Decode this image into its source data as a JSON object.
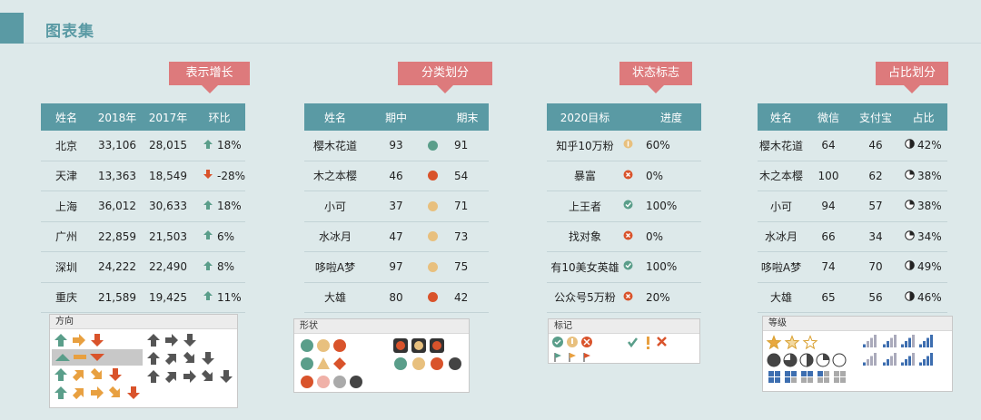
{
  "header": {
    "title": "图表集"
  },
  "callouts": {
    "c1": "表示增长",
    "c2": "分类划分",
    "c3": "状态标志",
    "c4": "占比划分"
  },
  "table1": {
    "headers": [
      "姓名",
      "2018年",
      "2017年",
      "环比"
    ],
    "rows": [
      {
        "name": "北京",
        "y2018": "33,106",
        "y2017": "28,015",
        "trend": "up",
        "pct": "18%"
      },
      {
        "name": "天津",
        "y2018": "13,363",
        "y2017": "18,549",
        "trend": "down",
        "pct": "-28%"
      },
      {
        "name": "上海",
        "y2018": "36,012",
        "y2017": "30,633",
        "trend": "up",
        "pct": "18%"
      },
      {
        "name": "广州",
        "y2018": "22,859",
        "y2017": "21,503",
        "trend": "up",
        "pct": "6%"
      },
      {
        "name": "深圳",
        "y2018": "24,222",
        "y2017": "22,490",
        "trend": "up",
        "pct": "8%"
      },
      {
        "name": "重庆",
        "y2018": "21,589",
        "y2017": "19,425",
        "trend": "up",
        "pct": "11%"
      }
    ]
  },
  "table2": {
    "headers": [
      "姓名",
      "期中",
      "期末"
    ],
    "rows": [
      {
        "name": "樱木花道",
        "mid": "93",
        "final": "91",
        "color": "#5a9e8a"
      },
      {
        "name": "木之本樱",
        "mid": "46",
        "final": "54",
        "color": "#d9532b"
      },
      {
        "name": "小可",
        "mid": "37",
        "final": "71",
        "color": "#e8c07e"
      },
      {
        "name": "水冰月",
        "mid": "47",
        "final": "73",
        "color": "#e8c07e"
      },
      {
        "name": "哆啦A梦",
        "mid": "97",
        "final": "75",
        "color": "#e8c07e"
      },
      {
        "name": "大雄",
        "mid": "80",
        "final": "42",
        "color": "#d9532b"
      }
    ]
  },
  "table3": {
    "headers": [
      "2020目标",
      "进度"
    ],
    "rows": [
      {
        "goal": "知乎10万粉",
        "status": "warn",
        "progress": "60%"
      },
      {
        "goal": "暴富",
        "status": "x",
        "progress": "0%"
      },
      {
        "goal": "上王者",
        "status": "ok",
        "progress": "100%"
      },
      {
        "goal": "找对象",
        "status": "x",
        "progress": "0%"
      },
      {
        "goal": "有10美女英雄",
        "status": "ok",
        "progress": "100%"
      },
      {
        "goal": "公众号5万粉",
        "status": "x",
        "progress": "20%"
      }
    ]
  },
  "table4": {
    "headers": [
      "姓名",
      "微信",
      "支付宝",
      "占比"
    ],
    "rows": [
      {
        "name": "樱木花道",
        "wx": "64",
        "zfb": "46",
        "pct": "42%",
        "fill": 0.5
      },
      {
        "name": "木之本樱",
        "wx": "100",
        "zfb": "62",
        "pct": "38%",
        "fill": 0.25
      },
      {
        "name": "小可",
        "wx": "94",
        "zfb": "57",
        "pct": "38%",
        "fill": 0.25
      },
      {
        "name": "水冰月",
        "wx": "66",
        "zfb": "34",
        "pct": "34%",
        "fill": 0.25
      },
      {
        "name": "哆啦A梦",
        "wx": "74",
        "zfb": "70",
        "pct": "49%",
        "fill": 0.5
      },
      {
        "name": "大雄",
        "wx": "65",
        "zfb": "56",
        "pct": "46%",
        "fill": 0.5
      }
    ]
  },
  "panels": {
    "p1": "方向",
    "p2": "形状",
    "p3": "标记",
    "p4": "等级"
  },
  "colors": {
    "teal": "#5a9aa4",
    "callout": "#dd7a7c",
    "green": "#5a9e8a",
    "red": "#d9532b",
    "yellow": "#e8c07e"
  }
}
